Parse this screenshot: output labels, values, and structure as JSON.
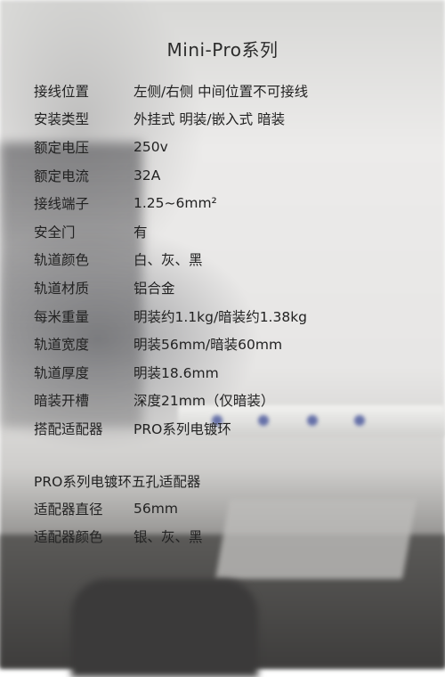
{
  "title": "Mini-Pro系列",
  "specs": [
    {
      "label": "接线位置",
      "value": "左侧/右侧  中间位置不可接线"
    },
    {
      "label": "安装类型",
      "value": "外挂式 明装/嵌入式 暗装"
    },
    {
      "label": "额定电压",
      "value": "250v"
    },
    {
      "label": "额定电流",
      "value": "32A"
    },
    {
      "label": "接线端子",
      "value": "1.25~6mm²"
    },
    {
      "label": "安全门",
      "value": "有"
    },
    {
      "label": "轨道颜色",
      "value": "白、灰、黑"
    },
    {
      "label": "轨道材质",
      "value": "铝合金"
    },
    {
      "label": "每米重量",
      "value": "明装约1.1kg/暗装约1.38kg"
    },
    {
      "label": "轨道宽度",
      "value": "明装56mm/暗装60mm"
    },
    {
      "label": "轨道厚度",
      "value": "明装18.6mm"
    },
    {
      "label": "暗装开槽",
      "value": "深度21mm（仅暗装）"
    },
    {
      "label": "搭配适配器",
      "value": "PRO系列电镀环"
    }
  ],
  "adapter": {
    "title": "PRO系列电镀环五孔适配器",
    "specs": [
      {
        "label": "适配器直径",
        "value": "56mm"
      },
      {
        "label": "适配器颜色",
        "value": "银、灰、黑"
      }
    ]
  }
}
